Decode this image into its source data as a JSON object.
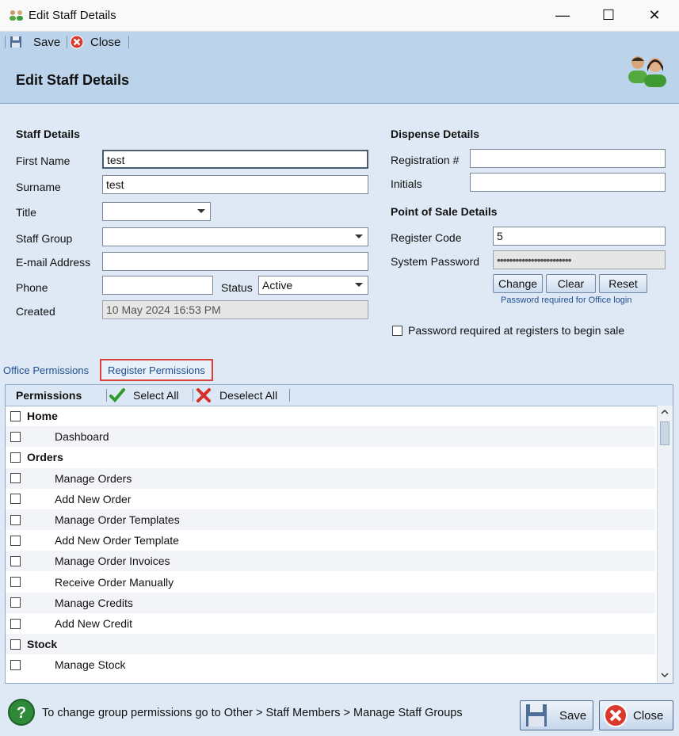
{
  "window": {
    "title": "Edit Staff Details",
    "minimize": "—",
    "maximize": "☐",
    "close": "✕"
  },
  "toolbar": {
    "save_label": "Save",
    "close_label": "Close"
  },
  "header": {
    "title": "Edit Staff Details"
  },
  "staff": {
    "section": "Staff Details",
    "first_name_label": "First Name",
    "first_name_value": "test",
    "surname_label": "Surname",
    "surname_value": "test",
    "title_label": "Title",
    "title_value": "",
    "group_label": "Staff Group",
    "group_value": "",
    "email_label": "E-mail Address",
    "email_value": "",
    "phone_label": "Phone",
    "phone_value": "",
    "status_label": "Status",
    "status_value": "Active",
    "created_label": "Created",
    "created_value": "10 May 2024 16:53 PM"
  },
  "dispense": {
    "section": "Dispense Details",
    "registration_label": "Registration #",
    "registration_value": "",
    "initials_label": "Initials",
    "initials_value": ""
  },
  "pos": {
    "section": "Point of Sale Details",
    "register_code_label": "Register Code",
    "register_code_value": "5",
    "password_label": "System Password",
    "password_value": "••••••••••••••••••••••••",
    "change_label": "Change",
    "clear_label": "Clear",
    "reset_label": "Reset",
    "note": "Password required for Office login",
    "checkbox_label": "Password required at registers to begin sale"
  },
  "tabs": {
    "office": "Office Permissions",
    "register": "Register Permissions"
  },
  "permissions": {
    "header": "Permissions",
    "select_all": "Select All",
    "deselect_all": "Deselect All",
    "rows": [
      {
        "label": "Home",
        "group": true
      },
      {
        "label": "Dashboard",
        "group": false
      },
      {
        "label": "Orders",
        "group": true
      },
      {
        "label": "Manage Orders",
        "group": false
      },
      {
        "label": "Add New Order",
        "group": false
      },
      {
        "label": "Manage Order Templates",
        "group": false
      },
      {
        "label": "Add New Order Template",
        "group": false
      },
      {
        "label": "Manage Order Invoices",
        "group": false
      },
      {
        "label": "Receive Order Manually",
        "group": false
      },
      {
        "label": "Manage Credits",
        "group": false
      },
      {
        "label": "Add New Credit",
        "group": false
      },
      {
        "label": "Stock",
        "group": true
      },
      {
        "label": "Manage Stock",
        "group": false
      }
    ]
  },
  "footer": {
    "hint": "To change group permissions go to Other > Staff Members > Manage Staff Groups",
    "save_label": "Save",
    "close_label": "Close"
  }
}
